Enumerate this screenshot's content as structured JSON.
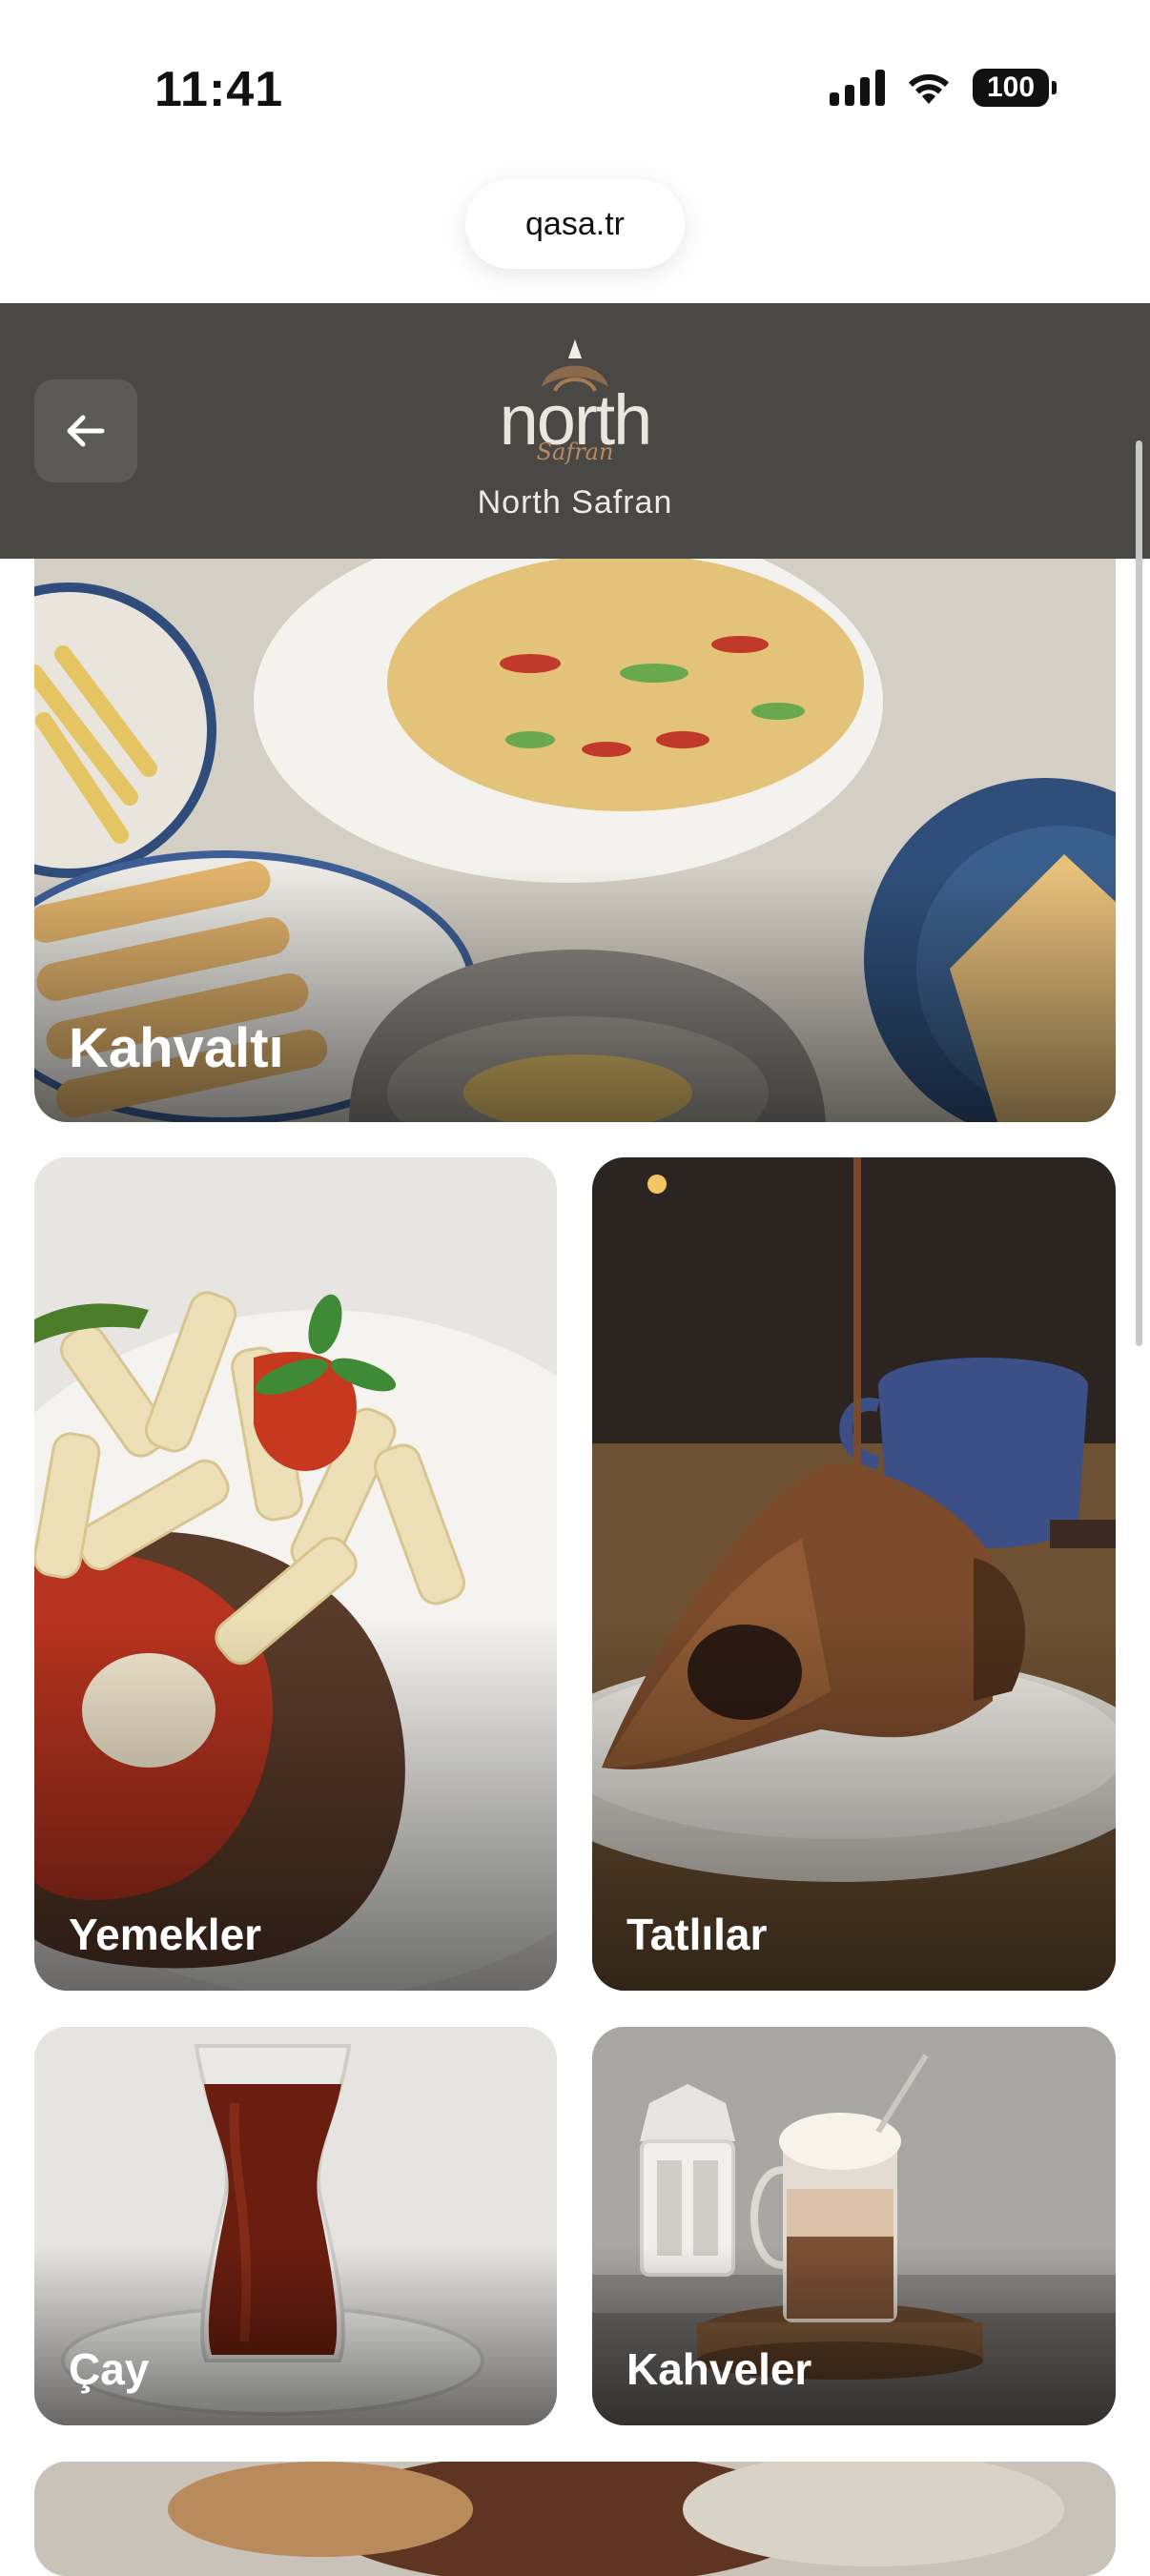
{
  "status_bar": {
    "time": "11:41",
    "battery": "100"
  },
  "browser": {
    "url": "qasa.tr"
  },
  "header": {
    "logo_text": "north",
    "logo_script": "Safran",
    "brand_name": "North Safran"
  },
  "categories": [
    {
      "label": "Kahvaltı"
    },
    {
      "label": "Yemekler"
    },
    {
      "label": "Tatlılar"
    },
    {
      "label": "Çay"
    },
    {
      "label": "Kahveler"
    }
  ]
}
